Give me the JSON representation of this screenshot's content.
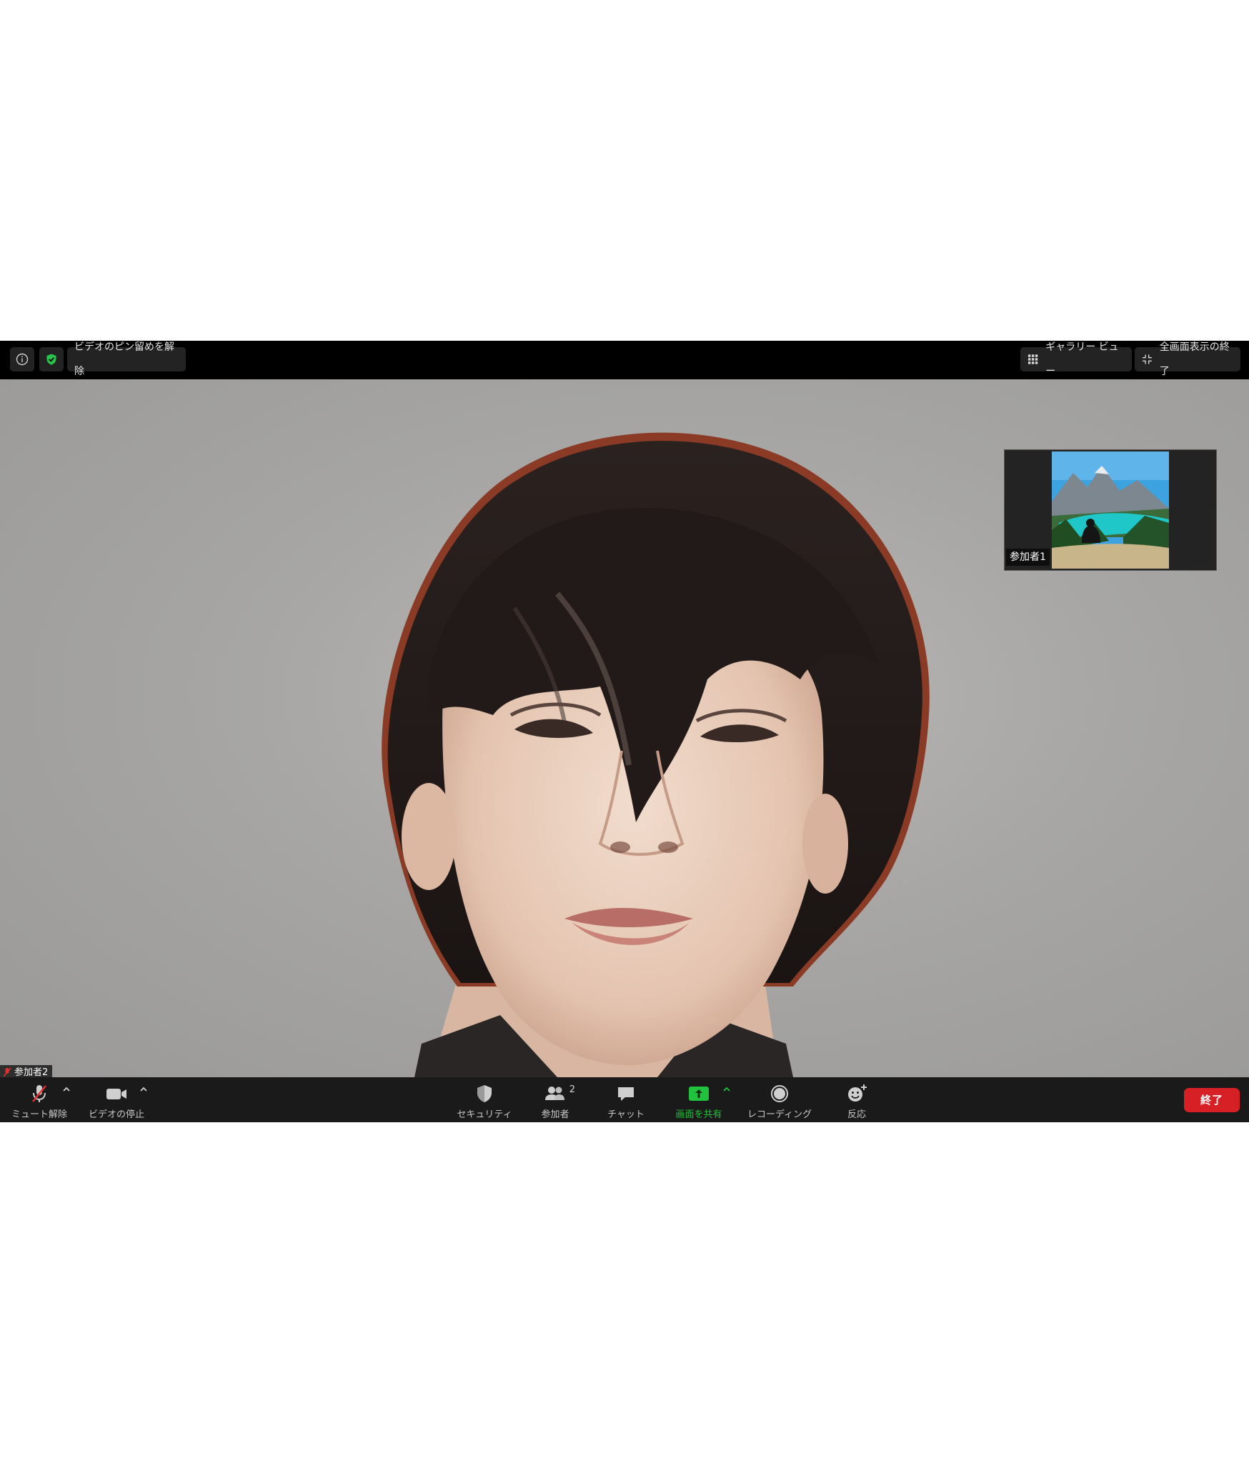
{
  "top_bar": {
    "unpin_label": "ビデオのピン留めを解除",
    "gallery_label": "ギャラリー ビュー",
    "exit_fullscreen_label": "全画面表示の終了"
  },
  "video": {
    "thumbnail_label": "参加者1",
    "main_label": "参加者2"
  },
  "toolbar": {
    "mute_label": "ミュート解除",
    "video_label": "ビデオの停止",
    "security_label": "セキュリティ",
    "participants_label": "参加者",
    "participants_count": "2",
    "chat_label": "チャット",
    "share_label": "画面を共有",
    "record_label": "レコーディング",
    "reactions_label": "反応",
    "end_label": "終了"
  },
  "colors": {
    "share_green": "#21c33c",
    "end_red": "#d62026",
    "shield_green": "#27c34a"
  }
}
